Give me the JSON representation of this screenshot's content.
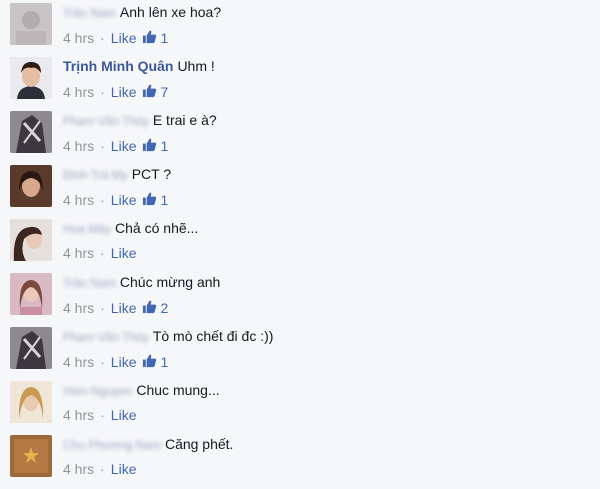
{
  "comments": [
    {
      "name": "Trần Nam",
      "blurred": true,
      "text": "Anh lên xe hoa?",
      "time": "4 hrs",
      "like": "Like",
      "likes": "1",
      "avatar": "blurred-gray"
    },
    {
      "name": "Trịnh Minh Quân",
      "blurred": false,
      "text": "Uhm !",
      "time": "4 hrs",
      "like": "Like",
      "likes": "7",
      "avatar": "man-portrait"
    },
    {
      "name": "Phạm Văn Thủy",
      "blurred": true,
      "text": "E trai e à?",
      "time": "4 hrs",
      "like": "Like",
      "likes": "1",
      "avatar": "dark-figure"
    },
    {
      "name": "Đinh Trà My",
      "blurred": true,
      "text": "PCT ?",
      "time": "4 hrs",
      "like": "Like",
      "likes": "1",
      "avatar": "woman-dark"
    },
    {
      "name": "Hoa Mây",
      "blurred": true,
      "text": "Chả có nhẽ...",
      "time": "4 hrs",
      "like": "Like",
      "likes": "",
      "avatar": "woman-light"
    },
    {
      "name": "Trần Nam",
      "blurred": true,
      "text": "Chúc mừng anh",
      "time": "4 hrs",
      "like": "Like",
      "likes": "2",
      "avatar": "woman-pink"
    },
    {
      "name": "Phạm Văn Thủy",
      "blurred": true,
      "text": "Tò mò chết đi đc :))",
      "time": "4 hrs",
      "like": "Like",
      "likes": "1",
      "avatar": "dark-figure"
    },
    {
      "name": "Hien Nguyen",
      "blurred": true,
      "text": "Chuc mung...",
      "time": "4 hrs",
      "like": "Like",
      "likes": "",
      "avatar": "woman-blonde"
    },
    {
      "name": "Chu Phương Nam",
      "blurred": true,
      "text": "Căng phết.",
      "time": "4 hrs",
      "like": "Like",
      "likes": "",
      "avatar": "brown-flag"
    }
  ]
}
